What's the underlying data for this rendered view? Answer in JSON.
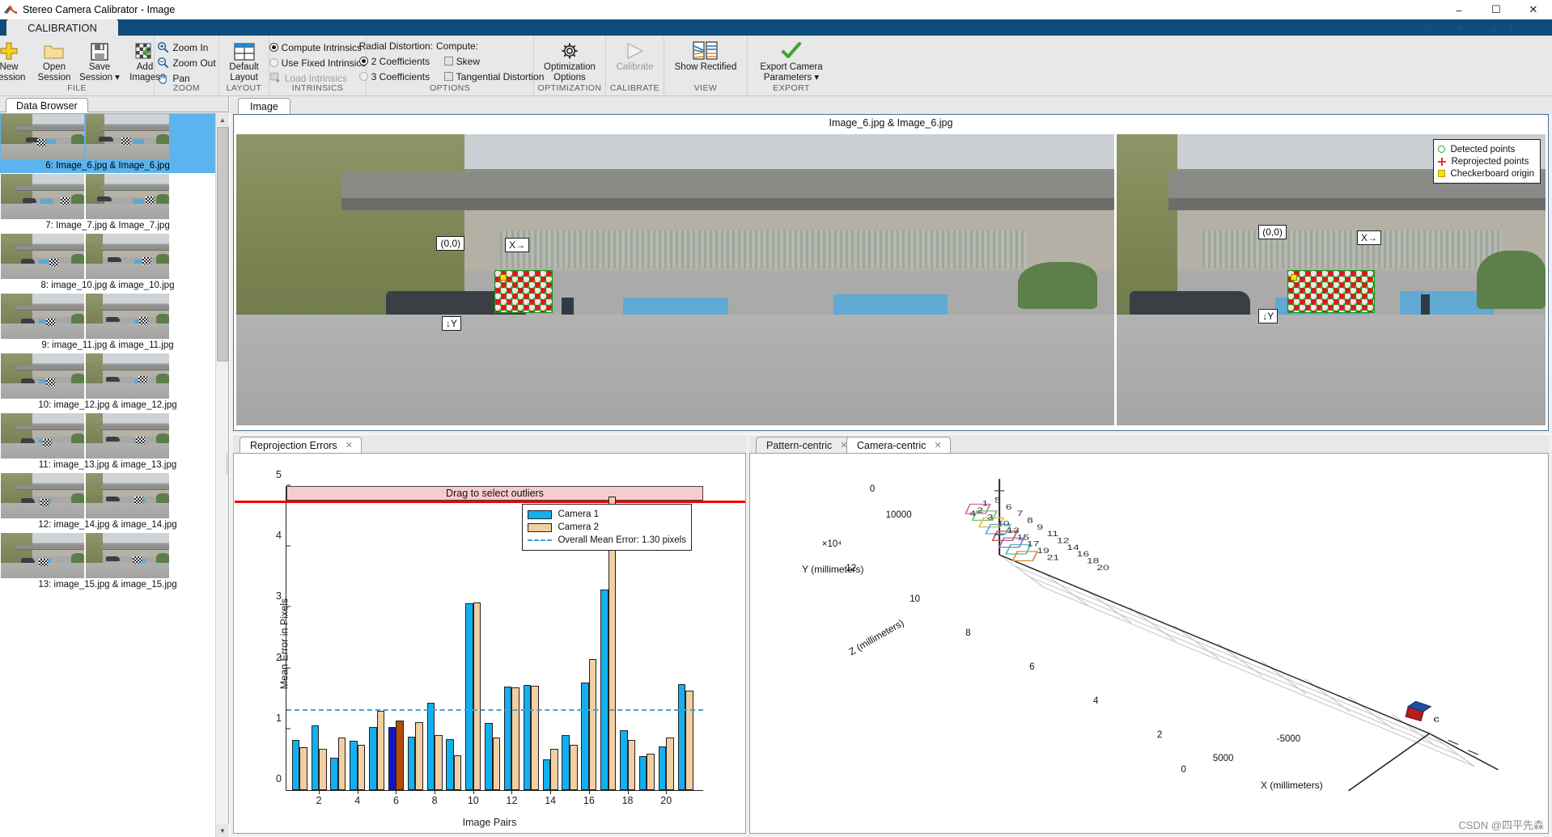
{
  "window": {
    "title": "Stereo Camera Calibrator - Image",
    "minimize": "–",
    "maximize": "☐",
    "close": "✕"
  },
  "ribbon": {
    "tab": "CALIBRATION",
    "groups": [
      {
        "label": "FILE",
        "buttons": [
          {
            "name": "new-session",
            "line1": "New",
            "line2": "Session",
            "icon": "plus-icon"
          },
          {
            "name": "open-session",
            "line1": "Open",
            "line2": "Session",
            "icon": "folder-icon"
          },
          {
            "name": "save-session",
            "line1": "Save",
            "line2": "Session ▾",
            "icon": "save-disk-icon"
          },
          {
            "name": "add-images",
            "line1": "Add",
            "line2": "Images",
            "icon": "checkerboard-plus-icon"
          }
        ]
      },
      {
        "label": "ZOOM",
        "items": [
          {
            "name": "zoom-in",
            "label": "Zoom In",
            "icon": "magnifier-plus-icon"
          },
          {
            "name": "zoom-out",
            "label": "Zoom Out",
            "icon": "magnifier-minus-icon"
          },
          {
            "name": "pan",
            "label": "Pan",
            "icon": "hand-icon"
          }
        ]
      },
      {
        "label": "LAYOUT",
        "buttons": [
          {
            "name": "default-layout",
            "line1": "Default",
            "line2": "Layout",
            "icon": "layout-grid-icon"
          }
        ]
      },
      {
        "label": "INTRINSICS",
        "options": [
          {
            "name": "compute-intrinsics",
            "label": "Compute Intrinsics",
            "control": "radio",
            "state": "on"
          },
          {
            "name": "use-fixed-intrinsics",
            "label": "Use Fixed Intrinsics",
            "control": "radio",
            "state": "off"
          },
          {
            "name": "load-intrinsics",
            "label": "Load Intrinsics",
            "control": "icon",
            "state": "disabled"
          }
        ]
      },
      {
        "label": "OPTIONS",
        "heading_left": "Radial Distortion:",
        "heading_right": "Compute:",
        "options": [
          {
            "name": "two-coefficients",
            "label": "2 Coefficients",
            "control": "radio",
            "state": "on"
          },
          {
            "name": "skew",
            "label": "Skew",
            "control": "checkbox",
            "state": "off"
          },
          {
            "name": "three-coefficients",
            "label": "3 Coefficients",
            "control": "radio",
            "state": "off"
          },
          {
            "name": "tangential-distortion",
            "label": "Tangential Distortion",
            "control": "checkbox",
            "state": "off"
          }
        ]
      },
      {
        "label": "OPTIMIZATION",
        "buttons": [
          {
            "name": "optimization-options",
            "line1": "Optimization",
            "line2": "Options",
            "icon": "gear-icon"
          }
        ]
      },
      {
        "label": "CALIBRATE",
        "buttons": [
          {
            "name": "calibrate",
            "line1": "Calibrate",
            "line2": "",
            "icon": "play-triangle-icon",
            "disabled": true
          }
        ]
      },
      {
        "label": "VIEW",
        "buttons": [
          {
            "name": "show-rectified",
            "line1": "Show Rectified",
            "line2": "",
            "icon": "rectified-stripes-icon"
          }
        ]
      },
      {
        "label": "EXPORT",
        "buttons": [
          {
            "name": "export-camera-parameters",
            "line1": "Export Camera",
            "line2": "Parameters ▾",
            "icon": "green-check-icon"
          }
        ]
      }
    ]
  },
  "data_browser": {
    "tab": "Data Browser",
    "items": [
      {
        "caption": "6: Image_6.jpg & Image_6.jpg",
        "selected": true
      },
      {
        "caption": "7: Image_7.jpg & Image_7.jpg",
        "selected": false
      },
      {
        "caption": "8: image_10.jpg & image_10.jpg",
        "selected": false
      },
      {
        "caption": "9: image_11.jpg & image_11.jpg",
        "selected": false
      },
      {
        "caption": "10: image_12.jpg & image_12.jpg",
        "selected": false
      },
      {
        "caption": "11: image_13.jpg & image_13.jpg",
        "selected": false
      },
      {
        "caption": "12: image_14.jpg & image_14.jpg",
        "selected": false
      },
      {
        "caption": "13: image_15.jpg & image_15.jpg",
        "selected": false
      }
    ]
  },
  "image_doc": {
    "tab": "Image",
    "title": "Image_6.jpg & Image_6.jpg",
    "overlay_left": {
      "origin": "(0,0)",
      "x_axis": "X→",
      "y_axis": "↓Y"
    },
    "overlay_right": {
      "origin": "(0,0)",
      "x_axis": "X→",
      "y_axis": "↓Y"
    },
    "legend": [
      {
        "icon": "green-circle-icon",
        "label": "Detected points"
      },
      {
        "icon": "red-plus-icon",
        "label": "Reprojected points"
      },
      {
        "icon": "yellow-square-icon",
        "label": "Checkerboard origin"
      }
    ]
  },
  "bottom_left": {
    "tab": "Reprojection Errors",
    "close": "✕"
  },
  "bottom_right": {
    "tabs": [
      {
        "label": "Pattern-centric",
        "active": false,
        "close": "✕"
      },
      {
        "label": "Camera-centric",
        "active": true,
        "close": "✕"
      }
    ]
  },
  "watermark": "CSDN @四平先森",
  "chart_data": [
    {
      "type": "bar",
      "title": "",
      "xlabel": "Image Pairs",
      "ylabel": "Mean Error in Pixels",
      "ylim": [
        0,
        5
      ],
      "yticks": [
        0,
        1,
        2,
        3,
        4,
        5
      ],
      "xticks": [
        2,
        4,
        6,
        8,
        10,
        12,
        14,
        16,
        18,
        20
      ],
      "grid": false,
      "annotation": "Drag to select outliers",
      "overall_mean": 1.3,
      "overall_mean_label": "Overall Mean Error: 1.30 pixels",
      "selected_pair": 6,
      "categories": [
        1,
        2,
        3,
        4,
        5,
        6,
        7,
        8,
        9,
        10,
        11,
        12,
        13,
        14,
        15,
        16,
        17,
        18,
        19,
        20,
        21
      ],
      "series": [
        {
          "name": "Camera 1",
          "color": "#12b0f0",
          "values": [
            0.82,
            1.06,
            0.53,
            0.81,
            1.04,
            1.04,
            0.88,
            1.44,
            0.84,
            3.07,
            1.11,
            1.7,
            1.73,
            0.51,
            0.91,
            1.77,
            3.3,
            0.98,
            0.56,
            0.72,
            1.74
          ]
        },
        {
          "name": "Camera 2",
          "color": "#f1cfa2",
          "values": [
            0.71,
            0.68,
            0.86,
            0.75,
            1.3,
            1.15,
            1.12,
            0.91,
            0.57,
            3.09,
            0.86,
            1.69,
            1.71,
            0.68,
            0.75,
            2.16,
            4.83,
            0.83,
            0.6,
            0.87,
            1.64
          ]
        }
      ],
      "legend": [
        "Camera 1",
        "Camera 2",
        "Overall Mean Error: 1.30 pixels"
      ],
      "legend_position": "top-right"
    },
    {
      "type": "scatter",
      "title": "",
      "projection": "3d",
      "xlabel": "X (millimeters)",
      "ylabel": "Y (millimeters)",
      "zlabel": "Z (millimeters)",
      "yticks": [
        "0",
        "10000"
      ],
      "zticks": [
        "2",
        "4",
        "6",
        "8",
        "10",
        "12"
      ],
      "z_exponent": "×10⁴",
      "xticks": [
        "-5000",
        "0",
        "5000"
      ],
      "pattern_labels": [
        "1",
        "2",
        "3",
        "4",
        "5",
        "6",
        "7",
        "8",
        "9",
        "10",
        "11",
        "12",
        "13",
        "14",
        "15",
        "16",
        "17",
        "18",
        "19",
        "20",
        "21"
      ],
      "camera_label": "c"
    }
  ]
}
